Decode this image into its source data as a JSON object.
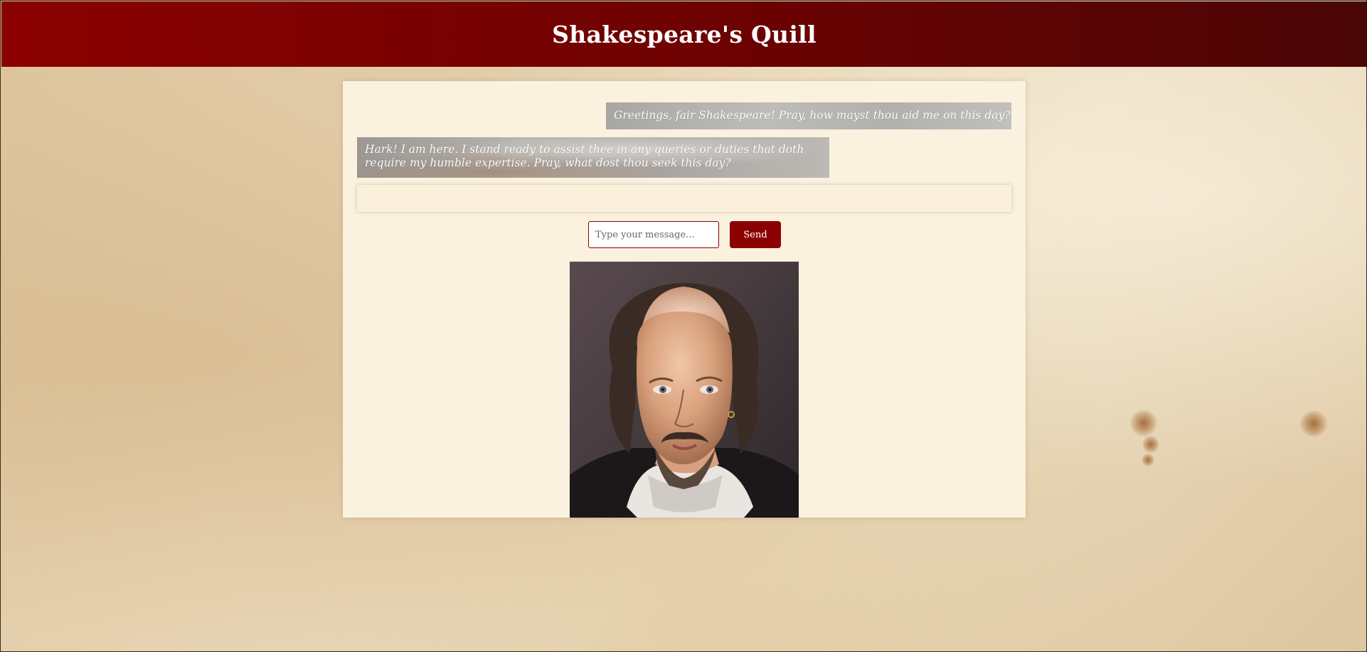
{
  "header": {
    "title": "Shakespeare's Quill"
  },
  "chat": {
    "messages": [
      {
        "role": "user",
        "text": "Greetings, fair Shakespeare! Pray, how mayst thou aid me on this day?"
      },
      {
        "role": "assistant",
        "text": "Hark! I am here. I stand ready to assist thee in any queries or duties that doth require my humble expertise. Pray, what dost thou seek this day?"
      }
    ]
  },
  "composer": {
    "placeholder": "Type your message...",
    "value": "",
    "send_label": "Send"
  },
  "colors": {
    "header_start": "#8b0000",
    "header_end": "#4a0505",
    "panel": "#faf1de",
    "accent": "#8b0000"
  }
}
